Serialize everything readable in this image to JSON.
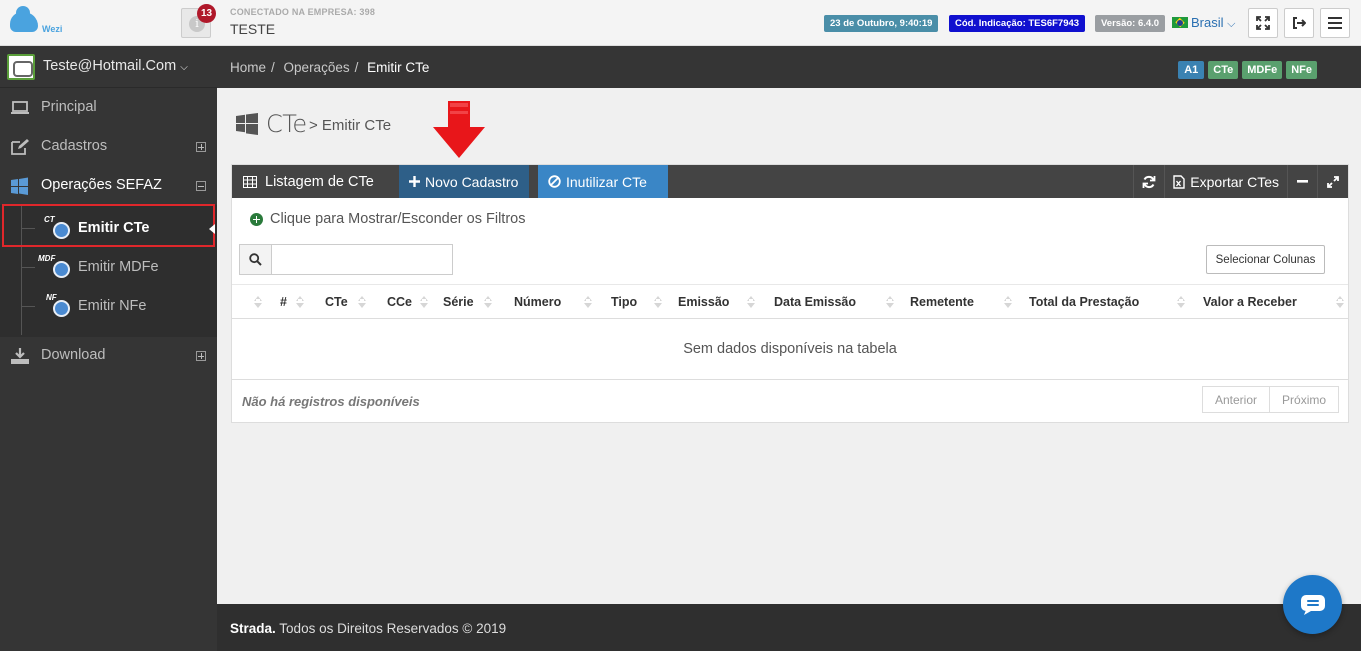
{
  "header": {
    "logo_text": "Wezi",
    "notification_count": "13",
    "notification_icon_letter": "i",
    "connected_label": "CONECTADO NA EMPRESA: 398",
    "company_name": "TESTE",
    "date_badge": "23 de Outubro, 9:40:19",
    "referral_badge": "Cód. Indicação: TES6F7943",
    "version_badge": "Versão: 6.4.0",
    "language": "Brasil",
    "language_chevron": "⌵",
    "colors": {
      "date": "#4a8ea8",
      "referral": "#1010cf",
      "version": "#9a9ea2"
    },
    "buttons": [
      "fullscreen-icon",
      "logout-icon",
      "menu-icon"
    ]
  },
  "sidebar": {
    "user_email": "Teste@Hotmail.Com",
    "user_chevron": "⌵",
    "items": [
      {
        "label": "Principal",
        "icon": "laptop-icon"
      },
      {
        "label": "Cadastros",
        "icon": "edit-icon",
        "toggle": "plus"
      },
      {
        "label": "Operações SEFAZ",
        "icon": "windows-icon",
        "toggle": "minus"
      },
      {
        "label": "Download",
        "icon": "download-icon",
        "toggle": "plus"
      }
    ],
    "subitems": [
      {
        "label": "Emitir CTe",
        "tag": "CT",
        "active": true
      },
      {
        "label": "Emitir MDFe",
        "tag": "MDF",
        "active": false
      },
      {
        "label": "Emitir NFe",
        "tag": "NF",
        "active": false
      }
    ]
  },
  "breadcrumb": {
    "home": "Home",
    "section": "Operações",
    "current": "Emitir CTe",
    "separator": "/",
    "tags": [
      "A1",
      "CTe",
      "MDFe",
      "NFe"
    ]
  },
  "page": {
    "title": "CTe",
    "subtitle": "> Emitir CTe"
  },
  "panel": {
    "title": "Listagem de CTe",
    "new_button": "Novo Cadastro",
    "disable_button": "Inutilizar CTe",
    "export_button": "Exportar CTes",
    "filter_toggle": "Clique para Mostrar/Esconder os Filtros",
    "search_value": "",
    "select_columns": "Selecionar Colunas",
    "columns": [
      "#",
      "CTe",
      "CCe",
      "Série",
      "Número",
      "Tipo",
      "Emissão",
      "Data Emissão",
      "Remetente",
      "Total da Prestação",
      "Valor a Receber"
    ],
    "empty_message": "Sem dados disponíveis na tabela",
    "info": "Não há registros disponíveis",
    "prev": "Anterior",
    "next": "Próximo"
  },
  "footer": {
    "brand": "Strada.",
    "text": "Todos os Direitos Reservados © 2019"
  }
}
